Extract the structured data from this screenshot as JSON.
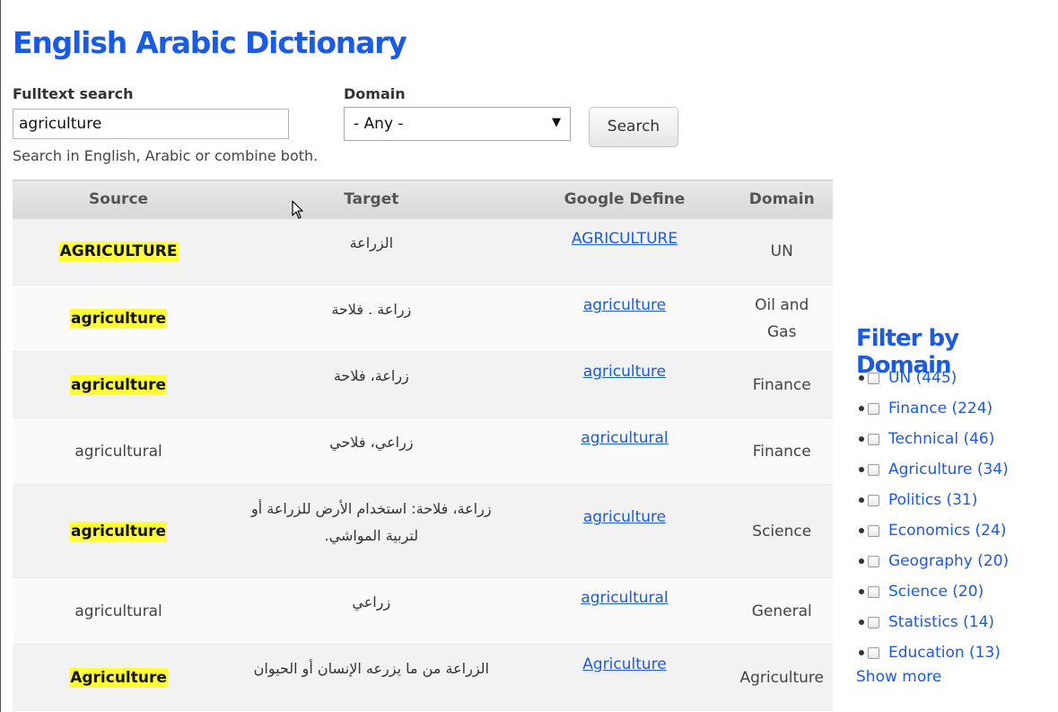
{
  "page": {
    "title": "English Arabic Dictionary"
  },
  "search": {
    "fulltext_label": "Fulltext search",
    "query": "agriculture",
    "hint": "Search in English, Arabic or combine both.",
    "domain_label": "Domain",
    "domain_selected": "- Any -",
    "button_label": "Search"
  },
  "table": {
    "headers": [
      "Source",
      "Target",
      "Google Define",
      "Domain"
    ],
    "rows": [
      {
        "source": "AGRICULTURE",
        "highlighted": true,
        "target": "الزراعة",
        "google": "AGRICULTURE",
        "domain": "UN"
      },
      {
        "source": "agriculture",
        "highlighted": true,
        "target": "زراعة . فلاحة",
        "google": "agriculture",
        "domain": "Oil and Gas"
      },
      {
        "source": "agriculture",
        "highlighted": true,
        "target": "زراعة، فلاحة",
        "google": "agriculture",
        "domain": "Finance"
      },
      {
        "source": "agricultural",
        "highlighted": false,
        "target": "زراعي، فلاحي",
        "google": "agricultural",
        "domain": "Finance"
      },
      {
        "source": "agriculture",
        "highlighted": true,
        "target": "زراعة، فلاحة: استخدام الأرض للزراعة أو لتربية المواشي.",
        "google": "agriculture",
        "domain": "Science"
      },
      {
        "source": "agricultural",
        "highlighted": false,
        "target": "زراعي",
        "google": "agricultural",
        "domain": "General"
      },
      {
        "source": "Agriculture",
        "highlighted": true,
        "target": "الزراعة من ما يزرعه الإنسان أو الحيوان",
        "google": "Agriculture",
        "domain": "Agriculture"
      }
    ]
  },
  "filter": {
    "title": "Filter by Domain",
    "items": [
      "UN (445)",
      "Finance (224)",
      "Technical (46)",
      "Agriculture (34)",
      "Politics (31)",
      "Economics (24)",
      "Geography (20)",
      "Science (20)",
      "Statistics (14)",
      "Education (13)"
    ],
    "show_more": "Show more"
  },
  "icons": {
    "select_arrow": "chevron-down-icon",
    "pointer": "mouse-cursor-icon",
    "bullet": "bullet-icon"
  },
  "colors": {
    "link": "#1a5ae8",
    "highlight": "#ffff33"
  }
}
